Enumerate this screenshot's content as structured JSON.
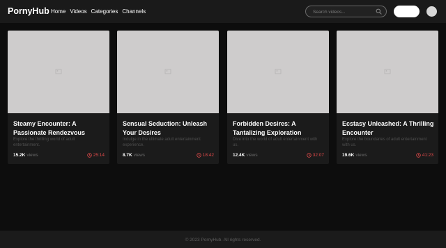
{
  "header": {
    "logo": "PornyHub",
    "nav": [
      "Home",
      "Videos",
      "Categories",
      "Channels"
    ],
    "search_placeholder": "Search videos...",
    "search_value": ""
  },
  "videos": [
    {
      "title": "Steamy Encounter: A Passionate Rendezvous",
      "description": "Explore the thrilling world of adult entertainment.",
      "views": "15.2K",
      "views_label": "views",
      "duration": "25:14"
    },
    {
      "title": "Sensual Seduction: Unleash Your Desires",
      "description": "Indulge in the ultimate adult entertainment experience.",
      "views": "8.7K",
      "views_label": "views",
      "duration": "18:42"
    },
    {
      "title": "Forbidden Desires: A Tantalizing Exploration",
      "description": "Dive into the world of adult entertainment with us.",
      "views": "12.4K",
      "views_label": "views",
      "duration": "32:07"
    },
    {
      "title": "Ecstasy Unleashed: A Thrilling Encounter",
      "description": "Explore the boundaries of adult entertainment with us.",
      "views": "19.6K",
      "views_label": "views",
      "duration": "41:23"
    }
  ],
  "footer": {
    "copyright": "© 2023 PornyHub. All rights reserved."
  },
  "colors": {
    "page_bg": "#0d0d0d",
    "header_bg": "#1a1a1a",
    "card_bg": "#1b1b1b",
    "thumbnail_placeholder": "#cecccc",
    "duration_accent": "#e34a4a"
  },
  "icons": {
    "search": "search-icon",
    "thumbnail": "image-placeholder-icon",
    "duration": "clock-icon"
  }
}
